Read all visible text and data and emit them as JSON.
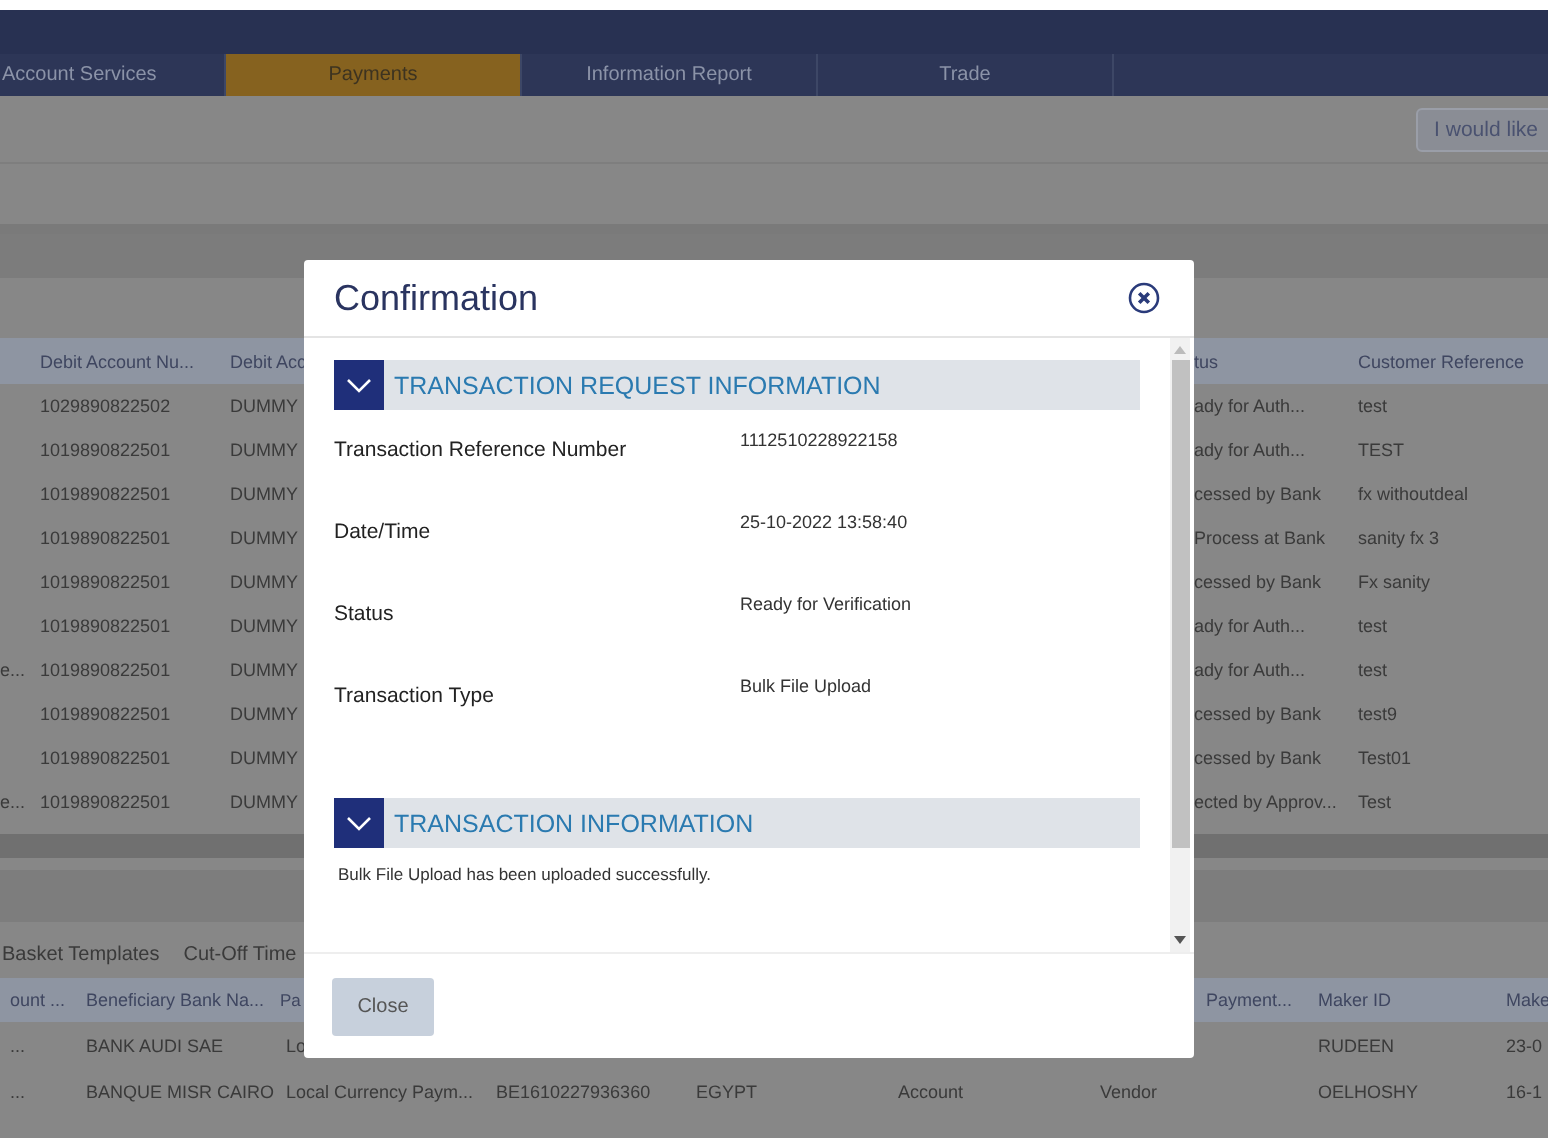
{
  "nav_tabs": [
    {
      "label": "Account Services",
      "selected": false
    },
    {
      "label": "Payments",
      "selected": true
    },
    {
      "label": "Information Report",
      "selected": false
    },
    {
      "label": "Trade",
      "selected": false
    }
  ],
  "action_button": "I would like",
  "transactions_table": {
    "header": {
      "debit_account_number": "Debit Account Nu...",
      "column_3": "Debit Acc",
      "column_4": "tus",
      "customer_reference": "Customer Reference"
    },
    "rows": [
      {
        "debit_account_number": "1029890822502",
        "column_3": "DUMMY",
        "column_4": "ady for Auth...",
        "customer_reference": "test"
      },
      {
        "debit_account_number": "1019890822501",
        "column_3": "DUMMY",
        "column_4": "ady for Auth...",
        "customer_reference": "TEST"
      },
      {
        "debit_account_number": "1019890822501",
        "column_3": "DUMMY",
        "column_4": "cessed by Bank",
        "customer_reference": "fx withoutdeal"
      },
      {
        "debit_account_number": "1019890822501",
        "column_3": "DUMMY",
        "column_4": "Process at Bank",
        "customer_reference": "sanity fx 3"
      },
      {
        "debit_account_number": "1019890822501",
        "column_3": "DUMMY",
        "column_4": "cessed by Bank",
        "customer_reference": "Fx sanity"
      },
      {
        "debit_account_number": "1019890822501",
        "column_3": "DUMMY",
        "column_4": "ady for Auth...",
        "customer_reference": "test"
      },
      {
        "column_1": "e...",
        "debit_account_number": "1019890822501",
        "column_3": "DUMMY",
        "column_4": "ady for Auth...",
        "customer_reference": "test"
      },
      {
        "debit_account_number": "1019890822501",
        "column_3": "DUMMY",
        "column_4": "cessed by Bank",
        "customer_reference": "test9"
      },
      {
        "debit_account_number": "1019890822501",
        "column_3": "DUMMY",
        "column_4": "cessed by Bank",
        "customer_reference": "Test01"
      },
      {
        "column_1": "e...",
        "debit_account_number": "1019890822501",
        "column_3": "DUMMY",
        "column_4": "ected by Approv...",
        "customer_reference": "Test"
      }
    ]
  },
  "lower_tabs": [
    "Basket Templates",
    "Cut-Off Time"
  ],
  "beneficiary_table": {
    "header": {
      "column_1": "ount ...",
      "beneficiary_bank": "Beneficiary Bank Na...",
      "column_3": "Pa",
      "column_7": "Payment...",
      "maker_id": "Maker ID",
      "column_9": "Make"
    },
    "rows": [
      {
        "column_1": "...",
        "beneficiary_bank": "BANK AUDI SAE",
        "column_3": "Lo",
        "maker_id": "RUDEEN",
        "column_9": "23-0"
      },
      {
        "column_1": "...",
        "beneficiary_bank": "BANQUE MISR CAIRO",
        "column_3": "Local Currency Paym...",
        "column_4": "BE1610227936360",
        "column_5": "EGYPT",
        "column_6": "Account",
        "column_7": "Vendor",
        "maker_id": "OELHOSHY",
        "column_9": "16-1"
      }
    ]
  },
  "dialog": {
    "title": "Confirmation",
    "sections": [
      {
        "title": "TRANSACTION REQUEST INFORMATION",
        "expanded": true,
        "fields": [
          {
            "label": "Transaction Reference Number",
            "value": "1112510228922158"
          },
          {
            "label": "Date/Time",
            "value": "25-10-2022 13:58:40"
          },
          {
            "label": "Status",
            "value": "Ready for Verification"
          },
          {
            "label": "Transaction Type",
            "value": "Bulk File Upload"
          }
        ]
      },
      {
        "title": "TRANSACTION INFORMATION",
        "expanded": true,
        "message": "Bulk File Upload has been uploaded successfully."
      }
    ],
    "button": "Close"
  }
}
